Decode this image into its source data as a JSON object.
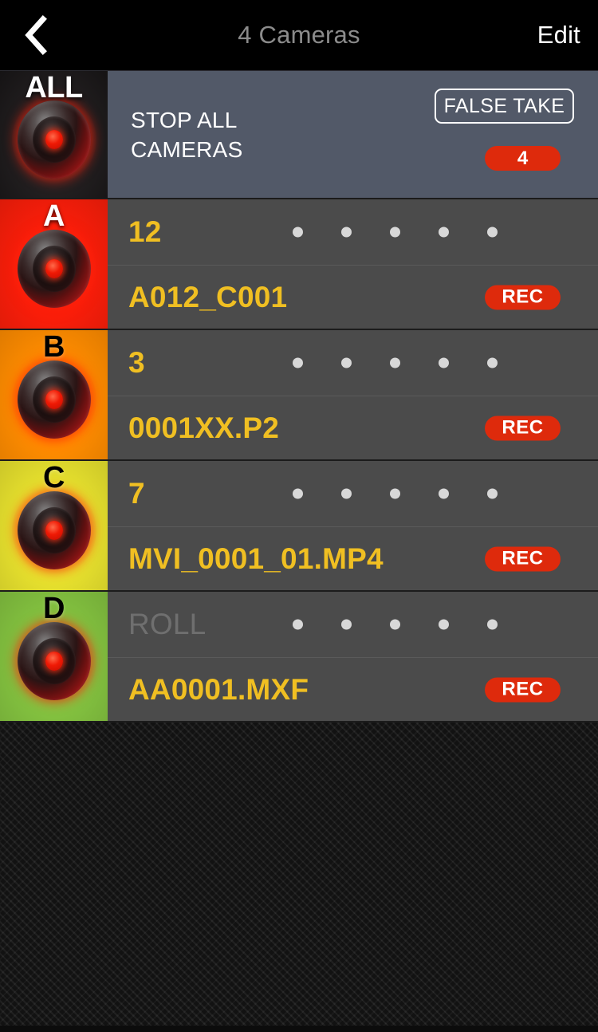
{
  "nav": {
    "back_icon": "chevron-left-icon",
    "title": "4 Cameras",
    "edit_label": "Edit"
  },
  "all_row": {
    "thumb_label": "ALL",
    "action_label": "STOP ALL CAMERAS",
    "action_label_line1": "STOP ALL",
    "action_label_line2": "CAMERAS",
    "false_take_label": "FALSE TAKE",
    "count_badge": "4",
    "panel_color": "#525968",
    "badge_color": "#de2a0c"
  },
  "cameras": [
    {
      "letter": "A",
      "color": "#fa1e0a",
      "letter_style": "light",
      "take": "12",
      "take_is_placeholder": false,
      "filename": "A012_C001",
      "rec_label": "REC",
      "dots": 5
    },
    {
      "letter": "B",
      "color": "#ff8c00",
      "letter_style": "dark",
      "take": "3",
      "take_is_placeholder": false,
      "filename": "0001XX.P2",
      "rec_label": "REC",
      "dots": 5
    },
    {
      "letter": "C",
      "color": "#e8e22e",
      "letter_style": "dark",
      "take": "7",
      "take_is_placeholder": false,
      "filename": "MVI_0001_01.MP4",
      "rec_label": "REC",
      "dots": 5
    },
    {
      "letter": "D",
      "color": "#84c340",
      "letter_style": "dark",
      "take": "ROLL",
      "take_is_placeholder": true,
      "filename": "AA0001.MXF",
      "rec_label": "REC",
      "dots": 5
    }
  ],
  "theme": {
    "value_color": "#f0bf22",
    "row_bg": "#4b4b4b",
    "nav_bg": "#000000"
  }
}
